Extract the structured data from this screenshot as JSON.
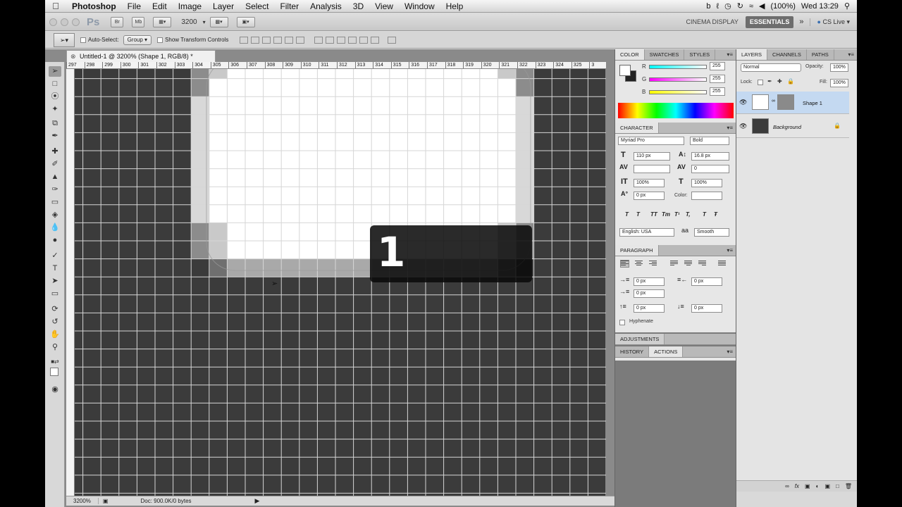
{
  "menubar": {
    "apple_icon": "apple-icon",
    "items": [
      "Photoshop",
      "File",
      "Edit",
      "Image",
      "Layer",
      "Select",
      "Filter",
      "Analysis",
      "3D",
      "View",
      "Window",
      "Help"
    ],
    "status": {
      "battery": "(100%)",
      "clock": "Wed 13:29"
    }
  },
  "appbar": {
    "logo": "Ps",
    "zoom": "3200",
    "workspace_other": "CINEMA DISPLAY",
    "workspace_active": "ESSENTIALS",
    "more": "»",
    "cslive": "CS Live"
  },
  "options": {
    "auto_select_label": "Auto-Select:",
    "auto_select_value": "Group",
    "show_transform_label": "Show Transform Controls"
  },
  "document": {
    "tab_title": "Untitled-1 @ 3200% (Shape 1, RGB/8) *",
    "ruler_ticks": [
      "297",
      "298",
      "299",
      "300",
      "301",
      "302",
      "303",
      "304",
      "305",
      "306",
      "307",
      "308",
      "309",
      "310",
      "311",
      "312",
      "313",
      "314",
      "315",
      "316",
      "317",
      "318",
      "319",
      "320",
      "321",
      "322",
      "323",
      "324",
      "325",
      "3"
    ],
    "overlay_number": "1"
  },
  "statusbar": {
    "zoom": "3200%",
    "doc_info": "Doc: 900.0K/0 bytes"
  },
  "color_panel": {
    "tabs": [
      "COLOR",
      "SWATCHES",
      "STYLES"
    ],
    "channels": [
      {
        "label": "R",
        "value": "255",
        "color": "#00ffff"
      },
      {
        "label": "G",
        "value": "255",
        "color": "#ff00ff"
      },
      {
        "label": "B",
        "value": "255",
        "color": "#ffff00"
      }
    ]
  },
  "character_panel": {
    "title": "CHARACTER",
    "font_family": "Myriad Pro",
    "font_style": "Bold",
    "size": "110 px",
    "leading": "16.8 px",
    "kerning": "",
    "tracking": "0",
    "vscale": "100%",
    "hscale": "100%",
    "baseline": "0 px",
    "color_label": "Color:",
    "language": "English: USA",
    "antialias": "Smooth",
    "style_buttons": [
      "T",
      "T",
      "TT",
      "Tт",
      "T¹",
      "T,",
      "T",
      "Ŧ"
    ]
  },
  "paragraph_panel": {
    "title": "PARAGRAPH",
    "indent_left": "0 px",
    "indent_right": "0 px",
    "indent_first": "0 px",
    "space_before": "0 px",
    "space_after": "0 px",
    "hyphenate_label": "Hyphenate"
  },
  "adjustments_panel": {
    "title": "ADJUSTMENTS"
  },
  "history_panel": {
    "tabs": [
      "HISTORY",
      "ACTIONS"
    ]
  },
  "layers_panel": {
    "tabs": [
      "LAYERS",
      "CHANNELS",
      "PATHS"
    ],
    "blend_mode": "Normal",
    "opacity_label": "Opacity:",
    "opacity_value": "100%",
    "lock_label": "Lock:",
    "fill_label": "Fill:",
    "fill_value": "100%",
    "layers": [
      {
        "name": "Shape 1",
        "selected": true
      },
      {
        "name": "Background",
        "selected": false
      }
    ]
  }
}
